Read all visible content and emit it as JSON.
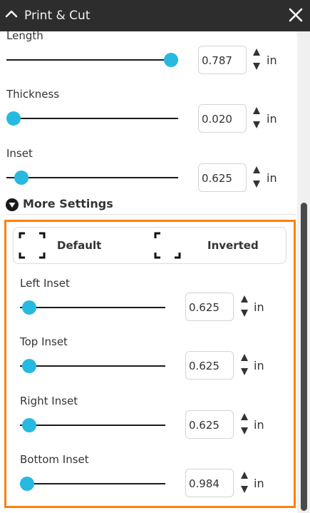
{
  "window": {
    "title": "Print & Cut",
    "collapse_icon": "chevron-up-icon",
    "close_icon": "close-icon"
  },
  "controls": [
    {
      "label": "Length",
      "value": "0.787",
      "unit": "in",
      "slider_fraction": 0.92
    },
    {
      "label": "Thickness",
      "value": "0.020",
      "unit": "in",
      "slider_fraction": 0.03
    },
    {
      "label": "Inset",
      "value": "0.625",
      "unit": "in",
      "slider_fraction": 0.08
    }
  ],
  "more_settings": {
    "label": "More Settings",
    "expanded": true,
    "mode_toggle": {
      "options": [
        "Default",
        "Inverted"
      ]
    },
    "insets": [
      {
        "label": "Left Inset",
        "value": "0.625",
        "unit": "in",
        "slider_fraction": 0.07
      },
      {
        "label": "Top Inset",
        "value": "0.625",
        "unit": "in",
        "slider_fraction": 0.07
      },
      {
        "label": "Right Inset",
        "value": "0.625",
        "unit": "in",
        "slider_fraction": 0.07
      },
      {
        "label": "Bottom Inset",
        "value": "0.984",
        "unit": "in",
        "slider_fraction": 0.06
      }
    ]
  },
  "colors": {
    "accent": "#27b9e0",
    "highlight_border": "#ff7f0e",
    "titlebar": "#2d2d2d"
  }
}
